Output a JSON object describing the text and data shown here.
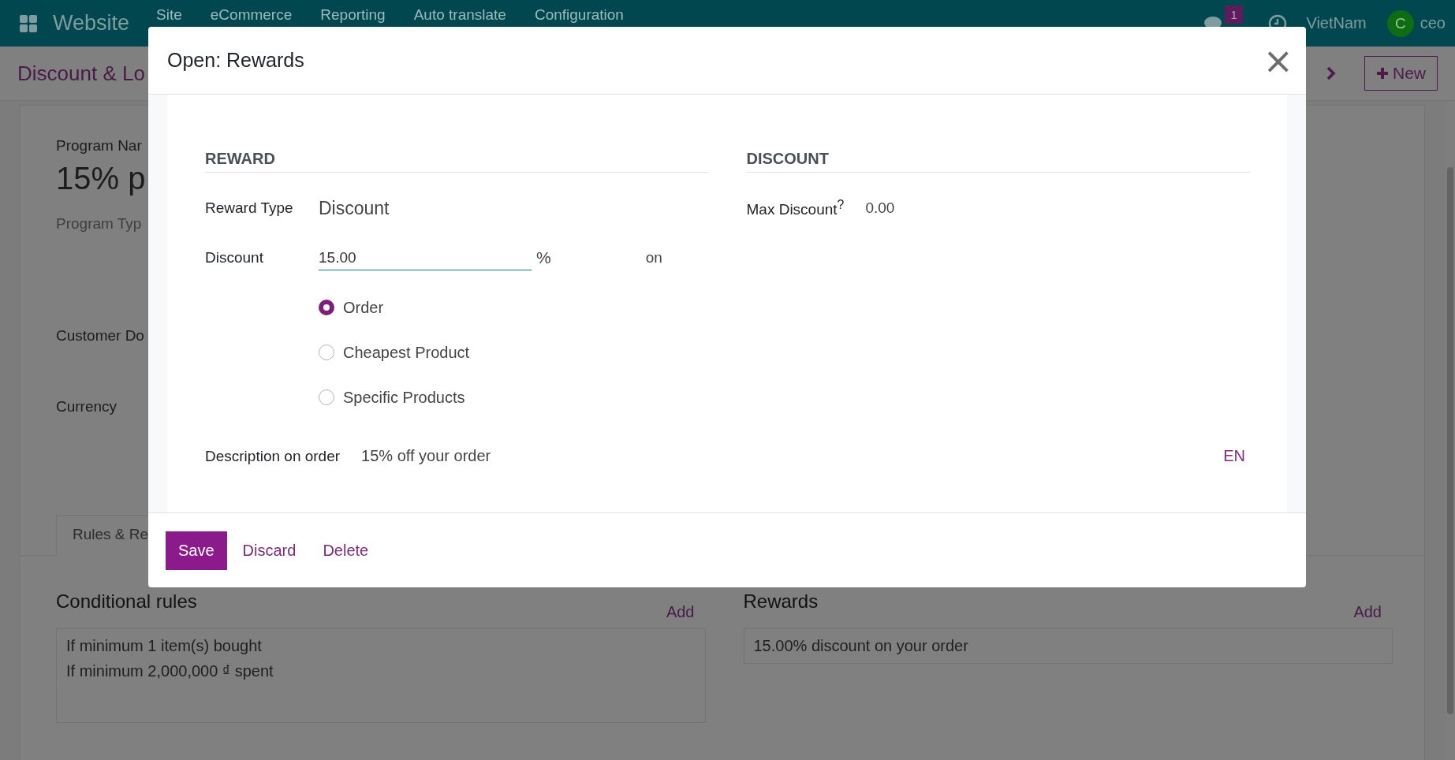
{
  "navbar": {
    "app_name": "Website",
    "menus": [
      "Site",
      "eCommerce",
      "Reporting",
      "Auto translate",
      "Configuration"
    ],
    "message_count": "1",
    "company": "VietNam",
    "avatar_letter": "C",
    "user": "ceo"
  },
  "control_panel": {
    "breadcrumb": "Discount & Lo",
    "new_button": "New"
  },
  "form": {
    "program_name_label": "Program Nar",
    "program_name": "15% p",
    "program_type_label": "Program Typ",
    "customer_label": "Customer Do",
    "currency_label": "Currency",
    "tabs": [
      {
        "label": "Rules & Re",
        "selected": true
      }
    ],
    "conditional_rules": {
      "title": "Conditional rules",
      "add": "Add",
      "lines": [
        "If minimum 1 item(s) bought",
        "If minimum 2,000,000 ₫ spent"
      ]
    },
    "rewards": {
      "title": "Rewards",
      "add": "Add",
      "lines": [
        "15.00% discount on your order"
      ]
    }
  },
  "dialog": {
    "title": "Open: Rewards",
    "close": "×",
    "reward_heading": "REWARD",
    "discount_heading": "DISCOUNT",
    "reward_type_label": "Reward Type",
    "reward_type": "Discount",
    "discount_label": "Discount",
    "discount_value": "15.00",
    "discount_unit": "%",
    "on_label": "on",
    "apply_on": [
      {
        "label": "Order",
        "selected": true
      },
      {
        "label": "Cheapest Product",
        "selected": false
      },
      {
        "label": "Specific Products",
        "selected": false
      }
    ],
    "max_discount_label": "Max Discount$^{?}$",
    "max_discount": "0.00",
    "description_label": "Description on order",
    "description": "15% off your order",
    "language": "EN",
    "buttons": [
      {
        "label": "Save",
        "kind": "primary"
      },
      {
        "label": "Discard",
        "kind": "link"
      },
      {
        "label": "Delete",
        "kind": "link"
      }
    ]
  }
}
